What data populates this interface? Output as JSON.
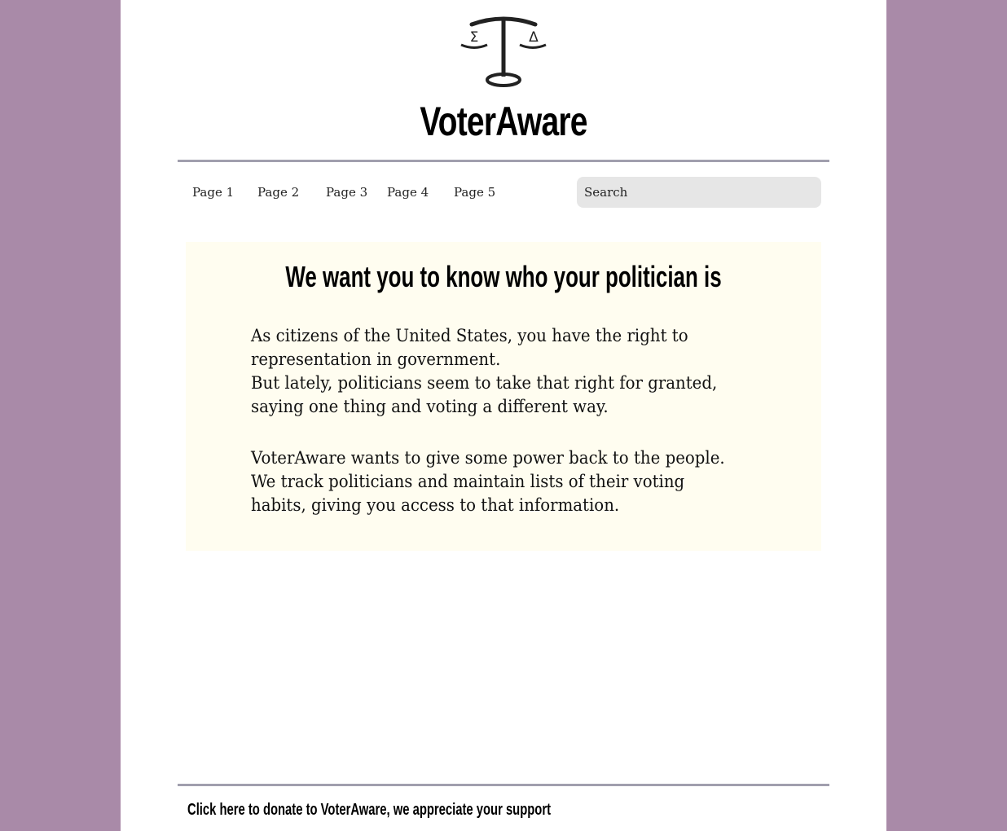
{
  "brand": {
    "name": "VoterAware",
    "logo_symbols": {
      "left": "Σ",
      "right": "Δ"
    },
    "logo_icon": "scales-of-justice-icon"
  },
  "nav": {
    "items": [
      {
        "label": "Page 1"
      },
      {
        "label": "Page 2"
      },
      {
        "label": "Page 3"
      },
      {
        "label": "Page 4"
      },
      {
        "label": "Page 5"
      }
    ]
  },
  "search": {
    "placeholder": "Search",
    "value": ""
  },
  "main": {
    "headline": "We want you to know who your politician is",
    "paragraph1": [
      "As citizens of the United States, you have the right to",
      "representation in government.",
      "But lately, politicians seem to take that right for granted,",
      "saying one thing and voting a different way."
    ],
    "paragraph2": [
      "VoterAware wants to give some power back to the people.",
      "We track politicians and maintain lists of their voting",
      "habits, giving you access to that information."
    ]
  },
  "footer": {
    "donate_text": "Click here to donate to VoterAware, we appreciate your support"
  },
  "colors": {
    "background": "#a98aa8",
    "page": "#ffffff",
    "rule": "#a19fae",
    "content_box": "#fffdf0",
    "search_bg": "#e6e6e6"
  }
}
